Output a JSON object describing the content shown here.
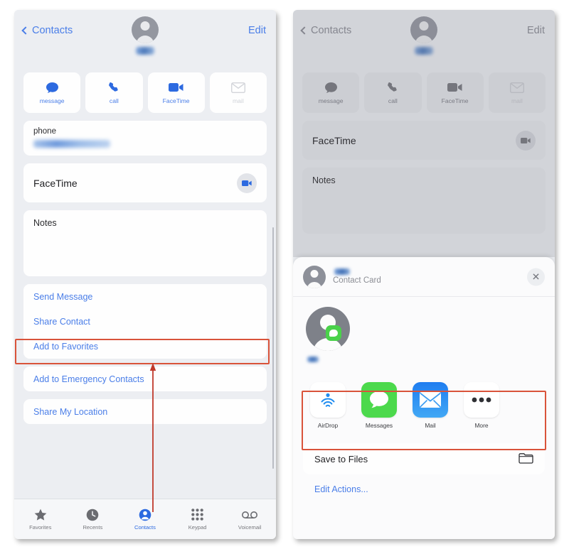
{
  "left_panel": {
    "nav": {
      "back_label": "Contacts",
      "edit_label": "Edit",
      "back_icon": "chevron-left-icon",
      "avatar_icon": "contact-avatar-icon"
    },
    "quick_actions": [
      {
        "label": "message",
        "icon": "message-bubble-icon",
        "enabled": true
      },
      {
        "label": "call",
        "icon": "phone-handset-icon",
        "enabled": true
      },
      {
        "label": "FaceTime",
        "icon": "video-camera-icon",
        "enabled": true
      },
      {
        "label": "mail",
        "icon": "envelope-icon",
        "enabled": false
      }
    ],
    "fields": {
      "phone_label": "phone",
      "facetime_label": "FaceTime",
      "facetime_icon": "video-camera-icon",
      "notes_label": "Notes"
    },
    "actions_group_1": [
      "Send Message",
      "Share Contact",
      "Add to Favorites"
    ],
    "actions_group_2": [
      "Add to Emergency Contacts"
    ],
    "actions_group_3": [
      "Share My Location"
    ],
    "tabbar": [
      {
        "label": "Favorites",
        "icon": "star-icon",
        "active": false
      },
      {
        "label": "Recents",
        "icon": "clock-icon",
        "active": false
      },
      {
        "label": "Contacts",
        "icon": "person-circle-icon",
        "active": true
      },
      {
        "label": "Keypad",
        "icon": "keypad-grid-icon",
        "active": false
      },
      {
        "label": "Voicemail",
        "icon": "voicemail-icon",
        "active": false
      }
    ]
  },
  "right_panel": {
    "nav": {
      "back_label": "Contacts",
      "edit_label": "Edit",
      "back_icon": "chevron-left-icon",
      "avatar_icon": "contact-avatar-icon"
    },
    "quick_actions": [
      {
        "label": "message",
        "icon": "message-bubble-icon",
        "enabled": true
      },
      {
        "label": "call",
        "icon": "phone-handset-icon",
        "enabled": true
      },
      {
        "label": "FaceTime",
        "icon": "video-camera-icon",
        "enabled": true
      },
      {
        "label": "mail",
        "icon": "envelope-icon",
        "enabled": false
      }
    ],
    "fields": {
      "facetime_label": "FaceTime",
      "facetime_icon": "video-camera-icon",
      "notes_label": "Notes"
    },
    "share_sheet": {
      "subtitle": "Contact Card",
      "close_icon": "close-x-icon",
      "apps": [
        {
          "label": "AirDrop",
          "icon": "airdrop-icon",
          "color": "#1f8cf0"
        },
        {
          "label": "Messages",
          "icon": "messages-app-icon",
          "color": "#4cd94c"
        },
        {
          "label": "Mail",
          "icon": "mail-app-icon",
          "color": "#2c8ef0"
        },
        {
          "label": "More",
          "icon": "more-dots-icon",
          "color": "#3b3c40"
        }
      ],
      "action_rows": [
        {
          "label": "Save to Files",
          "icon": "folder-icon"
        }
      ],
      "edit_actions_label": "Edit Actions..."
    }
  },
  "annotations": {
    "highlight_color": "#d9533a",
    "arrow_color": "#c0392b",
    "highlights": [
      {
        "name": "share-contact-highlight"
      },
      {
        "name": "share-apps-highlight"
      }
    ]
  }
}
